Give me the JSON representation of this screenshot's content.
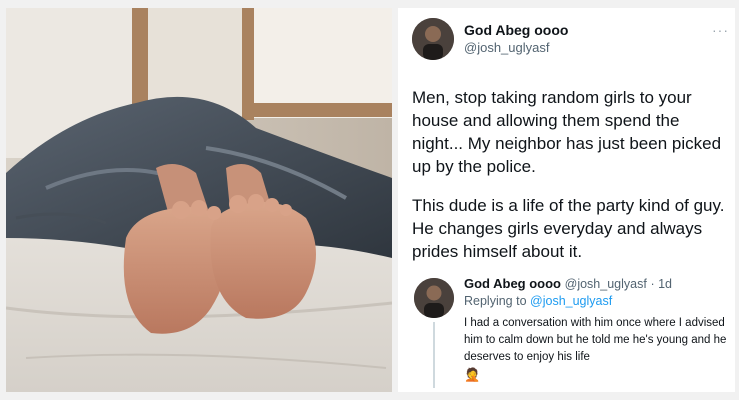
{
  "main_tweet": {
    "author_name": "God Abeg oooo",
    "author_handle": "@josh_uglyasf",
    "more_icon": "ellipsis-icon",
    "paragraph_1": "Men, stop taking random girls to your house and allowing them spend the night... My neighbor has just been picked up by the police.",
    "paragraph_2": "This dude is a life of the party kind of guy. He changes girls everyday and always prides himself about it."
  },
  "reply": {
    "author_name": "God Abeg oooo",
    "author_handle": "@josh_uglyasf",
    "time": "· 1d",
    "replying_prefix": "Replying to",
    "replying_handle": "@josh_uglyasf",
    "text": "I had a conversation with him once where I advised him to calm down but he told me he's young and he deserves to enjoy his life",
    "emoji": "🤦"
  },
  "colors": {
    "link": "#1d9bf0",
    "text": "#0f1419",
    "muted": "#536471"
  }
}
